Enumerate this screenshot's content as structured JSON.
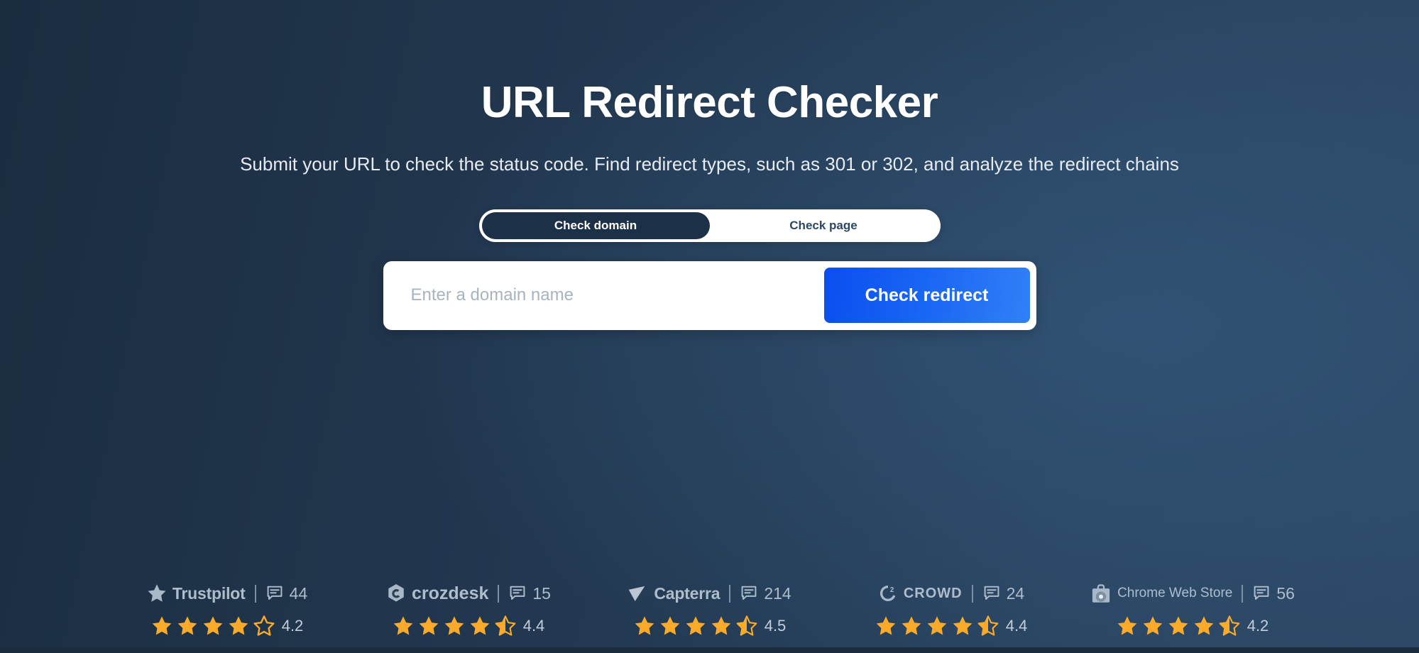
{
  "hero": {
    "title": "URL Redirect Checker",
    "subtitle": "Submit your URL to check the status code. Find redirect types, such as 301 or 302, and analyze the redirect chains"
  },
  "toggle": {
    "options": [
      {
        "label": "Check domain",
        "active": true
      },
      {
        "label": "Check page",
        "active": false
      }
    ]
  },
  "search": {
    "placeholder": "Enter a domain name",
    "value": "",
    "button_label": "Check redirect"
  },
  "colors": {
    "background_dark": "#1a2c40",
    "background_light": "#2b4764",
    "accent_blue": "#1866f4",
    "star_gold": "#fbaa29",
    "toggle_active": "#1c3047",
    "muted_text": "#aebdcc"
  },
  "reviews": [
    {
      "brand": "Trustpilot",
      "logo_icon": "trustpilot-star-icon",
      "count_icon": "comment-icon",
      "count": "44",
      "rating": "4.2",
      "full_stars": 4,
      "half_star": false,
      "empty_stars": 1
    },
    {
      "brand": "crozdesk",
      "logo_icon": "crozdesk-hexagon-icon",
      "count_icon": "comment-icon",
      "count": "15",
      "rating": "4.4",
      "full_stars": 4,
      "half_star": true,
      "empty_stars": 0
    },
    {
      "brand": "Capterra",
      "logo_icon": "capterra-arrow-icon",
      "count_icon": "comment-icon",
      "count": "214",
      "rating": "4.5",
      "full_stars": 4,
      "half_star": true,
      "empty_stars": 0
    },
    {
      "brand": "CROWD",
      "logo_icon": "g2-crowd-icon",
      "count_icon": "comment-icon",
      "count": "24",
      "rating": "4.4",
      "full_stars": 4,
      "half_star": true,
      "empty_stars": 0
    },
    {
      "brand": "Chrome Web Store",
      "logo_icon": "chrome-web-store-bag-icon",
      "count_icon": "comment-icon",
      "count": "56",
      "rating": "4.2",
      "full_stars": 4,
      "half_star": true,
      "empty_stars": 0
    }
  ]
}
